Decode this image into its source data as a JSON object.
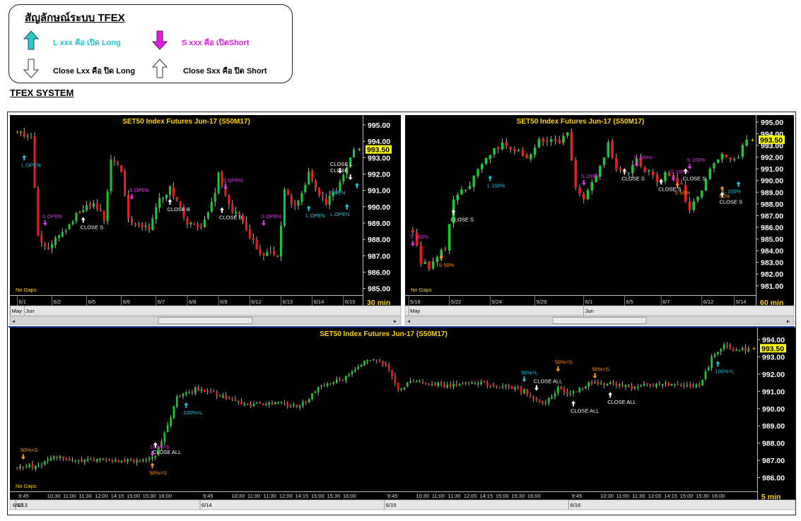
{
  "legend": {
    "title": "สัญลักษณ์ระบบ TFEX",
    "items": [
      {
        "text": "L xxx คือ เปิด Long",
        "color": "#29c4cf"
      },
      {
        "text": "S xxx คือ เปิดShort",
        "color": "#e01ee0"
      },
      {
        "text": "Close Lxx คือ ปิด Long",
        "color": "#000000"
      },
      {
        "text": "Close Sxx คือ ปิด Short",
        "color": "#000000"
      }
    ]
  },
  "system_title": "TFEX SYSTEM",
  "colors": {
    "chart_bg": "#000000",
    "up_candle": "#19c832",
    "down_candle": "#e61e1e",
    "title_text": "#ffd200",
    "long_signal": "#1ec8e6",
    "short_signal": "#e632e6",
    "close_signal": "#ffffff",
    "partial_signal": "#ff9614",
    "price_tag": "#ffff00"
  },
  "chart_data": [
    {
      "type": "candlestick",
      "title": "SET50  Index  Futures  Jun-17  (S50M17)",
      "timeframe": "30  min",
      "note": "No Gaps",
      "ylim": [
        984.6,
        995.6
      ],
      "yticks": [
        "995.00",
        "994.00",
        "993.00",
        "992.00",
        "991.00",
        "990.00",
        "989.00",
        "988.00",
        "987.00",
        "986.00",
        "985.00"
      ],
      "last_price": "993.50",
      "last_value": 993.5,
      "path": [
        [
          0,
          994.6
        ],
        [
          4,
          994.3
        ],
        [
          6,
          988.3
        ],
        [
          8,
          987.4
        ],
        [
          12,
          988.2
        ],
        [
          16,
          989.3
        ],
        [
          20,
          990.2
        ],
        [
          23,
          990.0
        ],
        [
          25,
          989.1
        ],
        [
          27,
          992.9
        ],
        [
          30,
          992.3
        ],
        [
          32,
          989.1
        ],
        [
          38,
          988.7
        ],
        [
          41,
          990.4
        ],
        [
          44,
          991.1
        ],
        [
          46,
          990.5
        ],
        [
          49,
          988.9
        ],
        [
          53,
          988.6
        ],
        [
          56,
          990.2
        ],
        [
          58,
          991.9
        ],
        [
          61,
          990.1
        ],
        [
          64,
          989.3
        ],
        [
          67,
          988.1
        ],
        [
          70,
          987.1
        ],
        [
          73,
          987.1
        ],
        [
          75,
          986.9
        ],
        [
          77,
          990.9
        ],
        [
          80,
          990.0
        ],
        [
          84,
          992.0
        ],
        [
          86,
          991.1
        ],
        [
          89,
          990.2
        ],
        [
          92,
          991.1
        ],
        [
          95,
          992.3
        ],
        [
          97,
          993.5
        ]
      ],
      "n_bars": 98,
      "date_labels": [
        {
          "i": 0,
          "t": "6/1"
        },
        {
          "i": 10,
          "t": "6/2"
        },
        {
          "i": 20,
          "t": "6/5"
        },
        {
          "i": 30,
          "t": "6/6"
        },
        {
          "i": 40,
          "t": "6/7"
        },
        {
          "i": 49,
          "t": "6/8"
        },
        {
          "i": 58,
          "t": "6/9"
        },
        {
          "i": 67,
          "t": "6/12"
        },
        {
          "i": 76,
          "t": "6/13"
        },
        {
          "i": 85,
          "t": "6/14"
        },
        {
          "i": 94,
          "t": "6/15"
        }
      ],
      "bottom_labels": [
        {
          "i": -2,
          "t": "May"
        },
        {
          "i": 2,
          "t": "Jun"
        }
      ],
      "signals": [
        {
          "i": 2,
          "price": 993.0,
          "dir": "up",
          "kind": "long",
          "label": "L OPEN"
        },
        {
          "i": 8,
          "price": 989.0,
          "dir": "down",
          "kind": "short",
          "label": "S OPEN"
        },
        {
          "i": 19,
          "price": 989.2,
          "dir": "up",
          "kind": "close",
          "label": "CLOSE  S"
        },
        {
          "i": 33,
          "price": 990.6,
          "dir": "down",
          "kind": "short",
          "label": "S  OPEN"
        },
        {
          "i": 44,
          "price": 990.3,
          "dir": "up",
          "kind": "close",
          "label": "CLOSE  B"
        },
        {
          "i": 60,
          "price": 991.2,
          "dir": "down",
          "kind": "short",
          "label": "S  OPEN"
        },
        {
          "i": 59,
          "price": 989.8,
          "dir": "up",
          "kind": "close",
          "label": "CLOSE  B"
        },
        {
          "i": 71,
          "price": 989.0,
          "dir": "down",
          "kind": "short",
          "label": "S  OPEN"
        },
        {
          "i": 84,
          "price": 989.9,
          "dir": "up",
          "kind": "long",
          "label": "L  OPEN"
        },
        {
          "i": 93,
          "price": 992.2,
          "dir": "down",
          "kind": "close",
          "label": "CLOSE  L"
        },
        {
          "i": 96,
          "price": 991.8,
          "dir": "down",
          "kind": "close",
          "label": "CLOSE"
        },
        {
          "i": 95,
          "price": 990.0,
          "dir": "up",
          "kind": "long",
          "label": "L  OPEN"
        },
        {
          "i": 101,
          "price": 991.3,
          "dir": "up",
          "kind": "long",
          "label": "OPEN"
        }
      ]
    },
    {
      "type": "candlestick",
      "title": "SET50  Index  Futures  Jun-17  (S50M17)",
      "timeframe": "60  min",
      "note": "No Gaps",
      "ylim": [
        980.2,
        995.6
      ],
      "yticks": [
        "995.00",
        "994.00",
        "993.00",
        "992.00",
        "991.00",
        "990.00",
        "989.00",
        "988.00",
        "987.00",
        "986.00",
        "985.00",
        "984.00",
        "983.00",
        "982.00",
        "981.00"
      ],
      "last_price": "993.50",
      "last_value": 993.5,
      "path": [
        [
          0,
          985.7
        ],
        [
          2,
          983.0
        ],
        [
          4,
          982.6
        ],
        [
          6,
          983.5
        ],
        [
          8,
          984.2
        ],
        [
          10,
          988.4
        ],
        [
          14,
          989.6
        ],
        [
          18,
          991.9
        ],
        [
          22,
          993.1
        ],
        [
          25,
          992.6
        ],
        [
          28,
          991.9
        ],
        [
          31,
          993.6
        ],
        [
          35,
          993.2
        ],
        [
          38,
          993.9
        ],
        [
          40,
          989.4
        ],
        [
          42,
          988.3
        ],
        [
          46,
          991.3
        ],
        [
          48,
          993.2
        ],
        [
          50,
          991.2
        ],
        [
          53,
          990.6
        ],
        [
          55,
          991.8
        ],
        [
          57,
          991.0
        ],
        [
          60,
          989.8
        ],
        [
          62,
          990.5
        ],
        [
          66,
          989.5
        ],
        [
          68,
          987.4
        ],
        [
          71,
          989.2
        ],
        [
          73,
          991.2
        ],
        [
          76,
          992.4
        ],
        [
          79,
          991.6
        ],
        [
          82,
          993.5
        ]
      ],
      "n_bars": 83,
      "date_labels": [
        {
          "i": -1,
          "t": "5/18"
        },
        {
          "i": 9,
          "t": "5/22"
        },
        {
          "i": 19,
          "t": "5/24"
        },
        {
          "i": 30,
          "t": "5/29"
        },
        {
          "i": 42,
          "t": "6/1"
        },
        {
          "i": 52,
          "t": "6/5"
        },
        {
          "i": 61,
          "t": "6/7"
        },
        {
          "i": 71,
          "t": "6/12"
        },
        {
          "i": 79,
          "t": "6/14"
        }
      ],
      "bottom_labels": [
        {
          "i": -1,
          "t": "May"
        },
        {
          "i": 42,
          "t": "Jun"
        }
      ],
      "signals": [
        {
          "i": 0,
          "price": 984.6,
          "dir": "down",
          "kind": "short",
          "label": "S  100%"
        },
        {
          "i": 7,
          "price": 983.4,
          "dir": "up",
          "kind": "partial",
          "label": "S  50%"
        },
        {
          "i": 10,
          "price": 987.3,
          "dir": "up",
          "kind": "close",
          "label": "CLOSE  S"
        },
        {
          "i": 19,
          "price": 990.2,
          "dir": "up",
          "kind": "long",
          "label": "L  100%"
        },
        {
          "i": 42,
          "price": 989.8,
          "dir": "down",
          "kind": "short",
          "label": "S  100%"
        },
        {
          "i": 52,
          "price": 990.8,
          "dir": "up",
          "kind": "close",
          "label": "CLOSE  S"
        },
        {
          "i": 55,
          "price": 991.4,
          "dir": "down",
          "kind": "short",
          "label": "S  100%"
        },
        {
          "i": 61,
          "price": 989.9,
          "dir": "up",
          "kind": "close",
          "label": "CLOSE  S"
        },
        {
          "i": 64,
          "price": 990.2,
          "dir": "down",
          "kind": "short",
          "label": "S  100%"
        },
        {
          "i": 65,
          "price": 989.6,
          "dir": "up",
          "kind": "partial",
          "label": "S  50%"
        },
        {
          "i": 67,
          "price": 990.8,
          "dir": "up",
          "kind": "close",
          "label": "CLOSE  S"
        },
        {
          "i": 68,
          "price": 991.2,
          "dir": "down",
          "kind": "short",
          "label": "S  100%"
        },
        {
          "i": 76,
          "price": 989.3,
          "dir": "up",
          "kind": "partial",
          "label": "50%"
        },
        {
          "i": 76,
          "price": 988.8,
          "dir": "up",
          "kind": "close",
          "label": "CLOSE  S"
        },
        {
          "i": 80,
          "price": 989.7,
          "dir": "up",
          "kind": "long",
          "label": "L  100%"
        }
      ]
    },
    {
      "type": "candlestick",
      "title": "SET50  Index  Futures  Jun-17  (S50M17)",
      "timeframe": "5  min",
      "note": "No Gaps",
      "ylim": [
        985.2,
        994.7
      ],
      "yticks": [
        "994.00",
        "993.00",
        "992.00",
        "991.00",
        "990.00",
        "989.00",
        "988.00",
        "987.00",
        "986.00"
      ],
      "last_price": "993.50",
      "last_value": 993.5,
      "path": [
        [
          0,
          986.6
        ],
        [
          8,
          986.7
        ],
        [
          12,
          987.3
        ],
        [
          18,
          986.9
        ],
        [
          28,
          987.1
        ],
        [
          38,
          986.9
        ],
        [
          45,
          987.3
        ],
        [
          48,
          988.5
        ],
        [
          52,
          990.6
        ],
        [
          58,
          991.1
        ],
        [
          66,
          990.8
        ],
        [
          74,
          990.2
        ],
        [
          84,
          990.3
        ],
        [
          92,
          990.1
        ],
        [
          98,
          991.2
        ],
        [
          106,
          991.7
        ],
        [
          112,
          992.6
        ],
        [
          116,
          992.8
        ],
        [
          120,
          992.5
        ],
        [
          124,
          991.2
        ],
        [
          130,
          991.6
        ],
        [
          140,
          991.3
        ],
        [
          150,
          991.5
        ],
        [
          158,
          991.3
        ],
        [
          165,
          991.0
        ],
        [
          172,
          990.3
        ],
        [
          176,
          991.2
        ],
        [
          180,
          990.8
        ],
        [
          186,
          991.5
        ],
        [
          194,
          991.5
        ],
        [
          200,
          991.2
        ],
        [
          210,
          991.5
        ],
        [
          218,
          991.3
        ],
        [
          222,
          991.4
        ],
        [
          226,
          992.9
        ],
        [
          230,
          993.7
        ],
        [
          234,
          993.3
        ],
        [
          238,
          993.5
        ]
      ],
      "n_bars": 239,
      "x_time_labels": [
        "9:45",
        "10:30",
        "11:00",
        "11:30",
        "12:00",
        "14:15",
        "15:00",
        "15:30",
        "16:00"
      ],
      "day_starts": [
        {
          "i": 0,
          "t": "6/13"
        },
        {
          "i": 60,
          "t": "6/14"
        },
        {
          "i": 120,
          "t": "6/15"
        },
        {
          "i": 180,
          "t": "6/16"
        }
      ],
      "bottom_first": "6/12",
      "signals": [
        {
          "i": 2,
          "price": 987.2,
          "dir": "down",
          "kind": "partial",
          "label": "50%=S"
        },
        {
          "i": 44,
          "price": 987.4,
          "dir": "down",
          "kind": "short",
          "label": "100%=S"
        },
        {
          "i": 45,
          "price": 987.9,
          "dir": "up",
          "kind": "close",
          "label": "CLOSE  ALL"
        },
        {
          "i": 44,
          "price": 986.7,
          "dir": "up",
          "kind": "partial",
          "label": "50%=S"
        },
        {
          "i": 55,
          "price": 990.2,
          "dir": "up",
          "kind": "long",
          "label": "100%=L"
        },
        {
          "i": 165,
          "price": 991.7,
          "dir": "down",
          "kind": "long",
          "label": "50%=L"
        },
        {
          "i": 169,
          "price": 991.2,
          "dir": "down",
          "kind": "close",
          "label": "CLOSE  ALL"
        },
        {
          "i": 176,
          "price": 992.3,
          "dir": "down",
          "kind": "partial",
          "label": "50%=S"
        },
        {
          "i": 181,
          "price": 990.3,
          "dir": "up",
          "kind": "close",
          "label": "CLOSE  ALL"
        },
        {
          "i": 188,
          "price": 991.9,
          "dir": "down",
          "kind": "partial",
          "label": "50%=S"
        },
        {
          "i": 193,
          "price": 990.8,
          "dir": "up",
          "kind": "close",
          "label": "CLOSE  ALL"
        },
        {
          "i": 228,
          "price": 992.6,
          "dir": "up",
          "kind": "long",
          "label": "100%=L"
        }
      ]
    }
  ]
}
